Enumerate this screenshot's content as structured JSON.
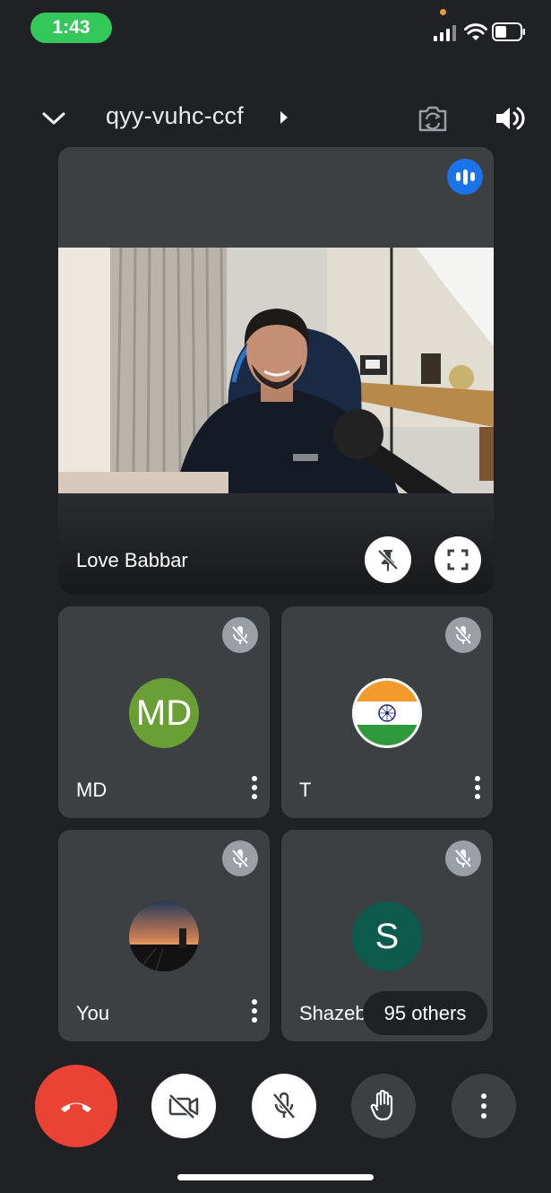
{
  "status_bar": {
    "time": "1:43"
  },
  "header": {
    "meeting_code": "qyy-vuhc-ccf"
  },
  "main_tile": {
    "participant_name": "Love Babbar"
  },
  "tiles": [
    {
      "name": "MD",
      "initials": "MD",
      "avatar_color": "#6a9f35"
    },
    {
      "name": "T",
      "initials": "",
      "avatar": "india-flag"
    },
    {
      "name": "You",
      "initials": "",
      "avatar": "sunset-photo"
    },
    {
      "name": "Shazeb",
      "initials": "S",
      "avatar_color": "#0d5b4c"
    }
  ],
  "others": {
    "label": "95 others"
  },
  "colors": {
    "end_call": "#ea4335",
    "speaking": "#1a73e8",
    "background": "#202124",
    "tile": "#3c4043"
  }
}
